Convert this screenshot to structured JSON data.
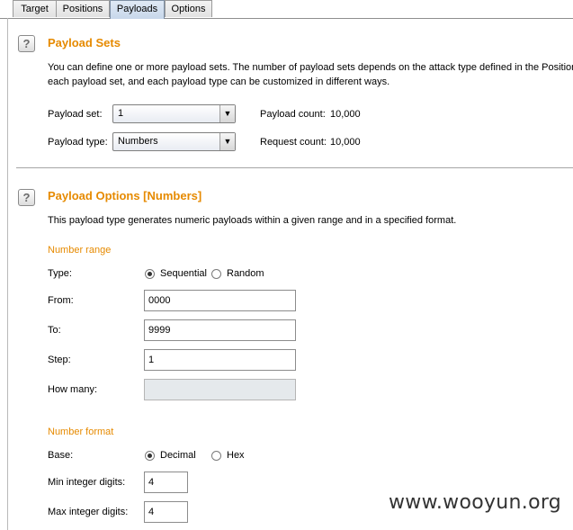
{
  "tabs": [
    {
      "label": "Target",
      "active": false
    },
    {
      "label": "Positions",
      "active": false
    },
    {
      "label": "Payloads",
      "active": true
    },
    {
      "label": "Options",
      "active": false
    }
  ],
  "help_glyph": "?",
  "payload_sets": {
    "title": "Payload Sets",
    "desc_line1": "You can define one or more payload sets. The number of payload sets depends on the attack type defined in the Positions",
    "desc_line2": "each payload set, and each payload type can be customized in different ways.",
    "set_label": "Payload set:",
    "set_value": "1",
    "type_label": "Payload type:",
    "type_value": "Numbers",
    "payload_count_label": "Payload count:",
    "payload_count_value": "10,000",
    "request_count_label": "Request count:",
    "request_count_value": "10,000"
  },
  "payload_options": {
    "title": "Payload Options [Numbers]",
    "desc": "This payload type generates numeric payloads within a given range and in a specified format.",
    "number_range": {
      "title": "Number range",
      "type_label": "Type:",
      "sequential_label": "Sequential",
      "random_label": "Random",
      "selected": "Sequential",
      "from_label": "From:",
      "from_value": "0000",
      "to_label": "To:",
      "to_value": "9999",
      "step_label": "Step:",
      "step_value": "1",
      "how_many_label": "How many:",
      "how_many_value": ""
    },
    "number_format": {
      "title": "Number format",
      "base_label": "Base:",
      "decimal_label": "Decimal",
      "hex_label": "Hex",
      "selected": "Decimal",
      "min_int_label": "Min integer digits:",
      "min_int_value": "4",
      "max_int_label": "Max integer digits:",
      "max_int_value": "4"
    }
  },
  "watermark": "www.wooyun.org"
}
